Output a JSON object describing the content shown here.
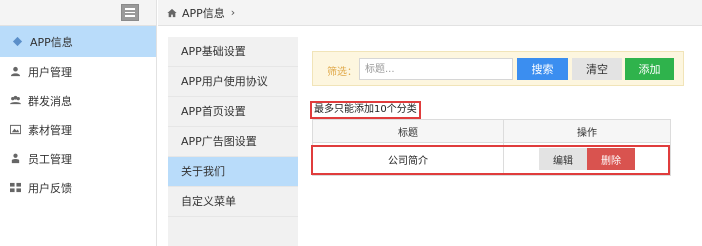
{
  "topbar": {
    "breadcrumb": "APP信息",
    "separator": "›"
  },
  "sidebar": {
    "items": [
      {
        "label": "APP信息",
        "icon": "diamond-icon",
        "active": true
      },
      {
        "label": "用户管理",
        "icon": "user-icon"
      },
      {
        "label": "群发消息",
        "icon": "group-icon"
      },
      {
        "label": "素材管理",
        "icon": "image-icon"
      },
      {
        "label": "员工管理",
        "icon": "staff-icon"
      },
      {
        "label": "用户反馈",
        "icon": "grid-icon"
      }
    ]
  },
  "submenu": {
    "items": [
      {
        "label": "APP基础设置"
      },
      {
        "label": "APP用户使用协议"
      },
      {
        "label": "APP首页设置"
      },
      {
        "label": "APP广告图设置"
      },
      {
        "label": "关于我们",
        "active": true
      },
      {
        "label": "自定义菜单"
      }
    ]
  },
  "filter": {
    "label": "筛选：",
    "placeholder": "标题...",
    "value": "",
    "search_label": "搜索",
    "clear_label": "清空",
    "add_label": "添加"
  },
  "notice": "最多只能添加10个分类",
  "table": {
    "headers": [
      "标题",
      "操作"
    ],
    "rows": [
      {
        "title": "公司简介",
        "edit_label": "编辑",
        "delete_label": "删除"
      }
    ]
  },
  "colors": {
    "active_bg": "#b9dcfa",
    "primary": "#3b8ef0",
    "success": "#2fb34c",
    "danger": "#d9534f",
    "highlight_border": "#e03c3c",
    "filter_bg": "#fdf6df"
  }
}
